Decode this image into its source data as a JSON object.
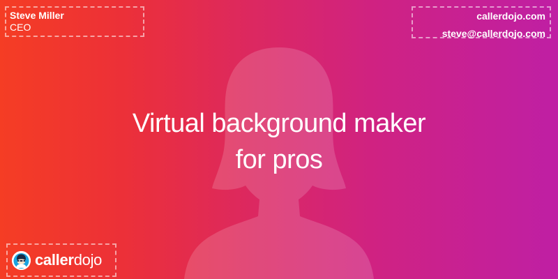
{
  "colors": {
    "gradient_start": "#f53d24",
    "gradient_end": "#bf1fa4",
    "text": "#ffffff",
    "logo_badge": "#ffffff",
    "logo_accent": "#1aa3e0"
  },
  "identity": {
    "name": "Steve Miller",
    "title": "CEO"
  },
  "contact": {
    "website": "callerdojo.com",
    "email": "steve@callerdojo.com"
  },
  "headline": {
    "line1": "Virtual background maker",
    "line2": "for pros"
  },
  "logo": {
    "icon": "callerdojo-mascot-icon",
    "text_strong": "caller",
    "text_light": "dojo"
  },
  "background": {
    "icon": "person-silhouette-icon"
  }
}
